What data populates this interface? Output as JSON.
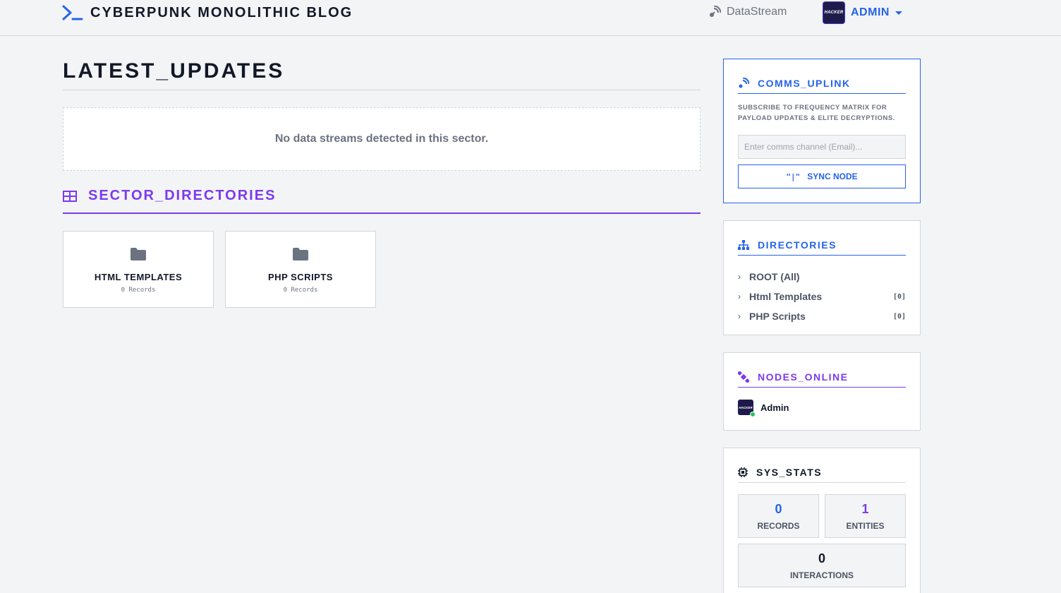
{
  "header": {
    "brand_title": "CYBERPUNK MONOLITHIC BLOG",
    "datastream_label": "DataStream",
    "avatar_text": "HACKER",
    "user_name": "ADMIN"
  },
  "main": {
    "latest_title": "LATEST_UPDATES",
    "empty_message": "No data streams detected in this sector.",
    "sector_title": "SECTOR_DIRECTORIES",
    "directories": [
      {
        "name": "HTML TEMPLATES",
        "count": "0 Records"
      },
      {
        "name": "PHP SCRIPTS",
        "count": "0 Records"
      }
    ]
  },
  "sidebar": {
    "uplink": {
      "title": "COMMS_UPLINK",
      "description": "SUBSCRIBE TO FREQUENCY MATRIX FOR PAYLOAD UPDATES & ELITE DECRYPTIONS.",
      "email_placeholder": "Enter comms channel (Email)...",
      "sync_icon": "\"|\"",
      "sync_label": "SYNC NODE"
    },
    "directories": {
      "title": "DIRECTORIES",
      "items": [
        {
          "label": "ROOT (All)",
          "badge": ""
        },
        {
          "label": "Html Templates",
          "badge": "[0]"
        },
        {
          "label": "PHP Scripts",
          "badge": "[0]"
        }
      ]
    },
    "nodes": {
      "title": "NODES_ONLINE",
      "avatar_text": "HACKER",
      "users": [
        "Admin"
      ]
    },
    "stats": {
      "title": "SYS_STATS",
      "records_value": "0",
      "records_label": "RECORDS",
      "entities_value": "1",
      "entities_label": "ENTITIES",
      "interactions_value": "0",
      "interactions_label": "INTERACTIONS"
    }
  },
  "colors": {
    "accent_blue": "#2563eb",
    "accent_purple": "#7c3aed",
    "online": "#22c55e"
  }
}
